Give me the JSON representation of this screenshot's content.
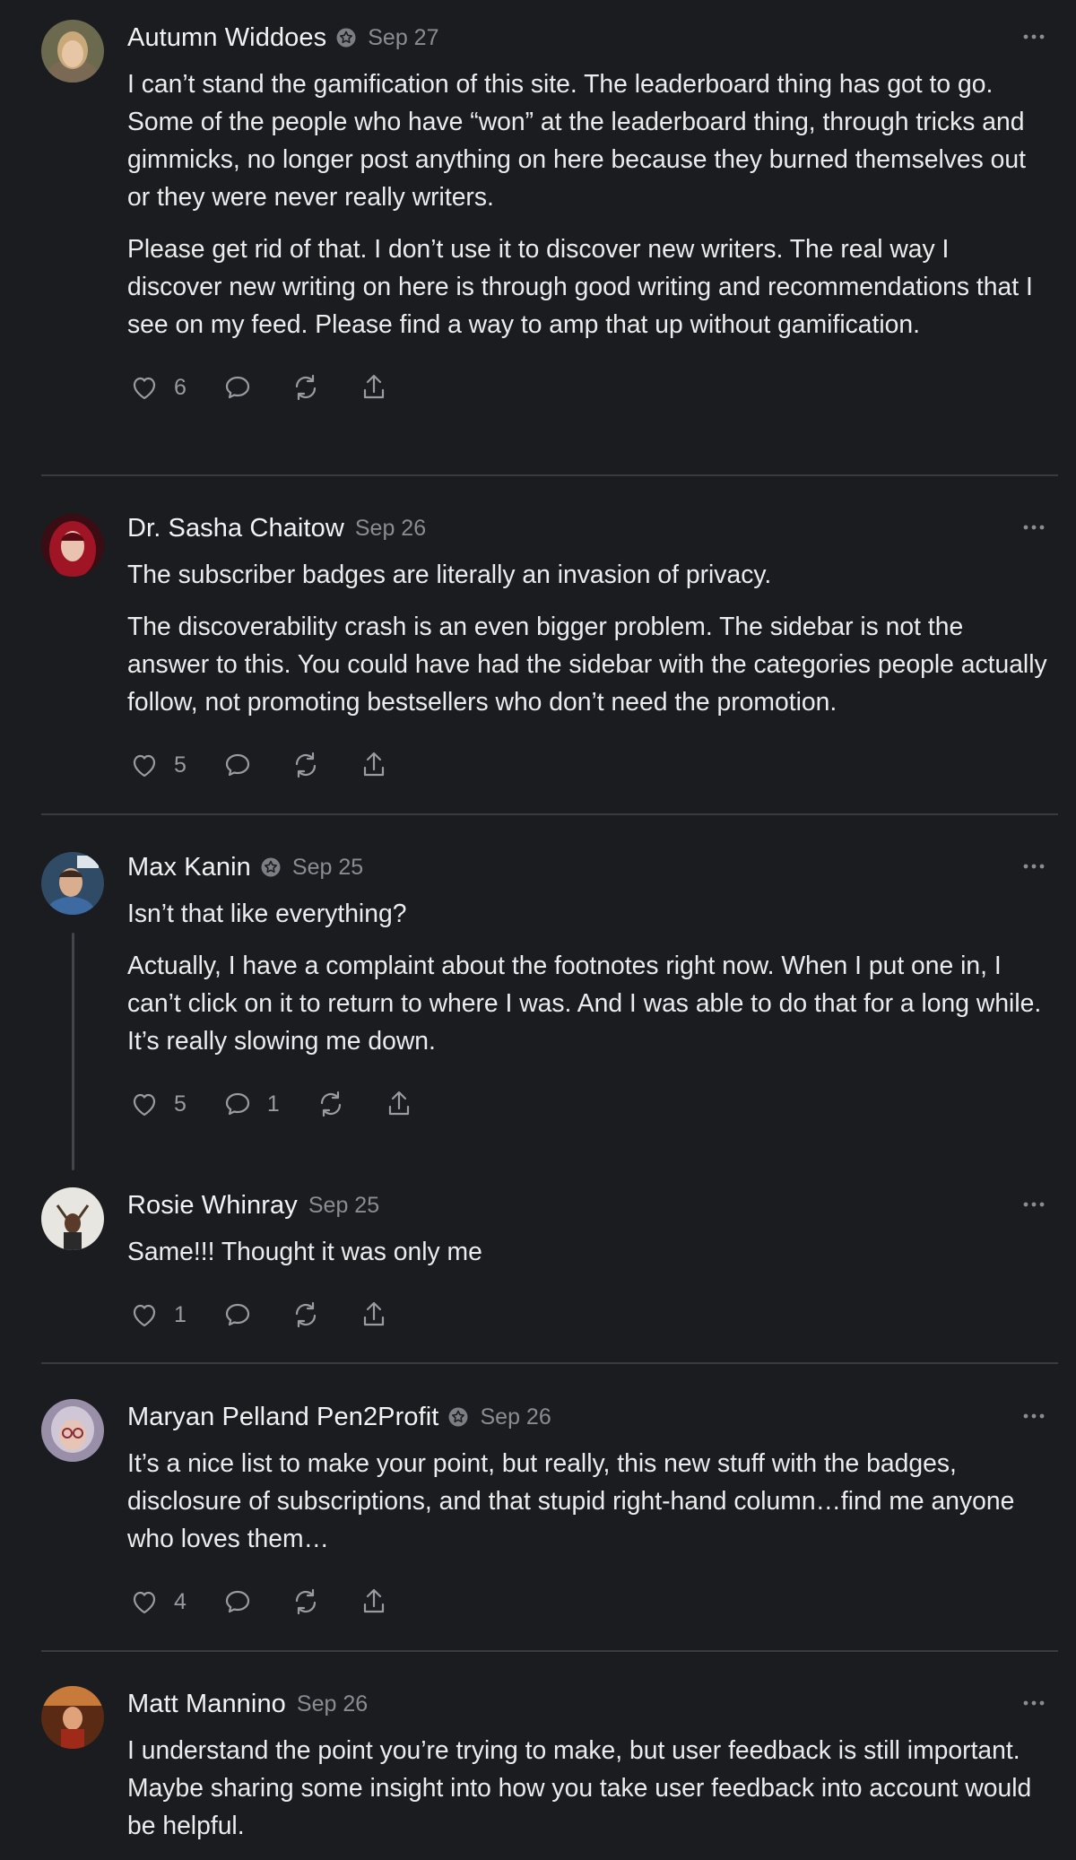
{
  "comments": [
    {
      "name": "Autumn Widdoes",
      "date": "Sep 27",
      "paragraphs": [
        "I can’t stand the gamification of this site. The leaderboard thing has got to go. Some of the people who have “won” at the leaderboard thing, through tricks and gimmicks, no longer post anything on here because they burned themselves out or they were never really writers.",
        "Please get rid of that. I don’t use it to discover new writers. The real way I discover new writing on here is through good writing and recommendations that I see on my feed. Please find a way to amp that up without gamification."
      ],
      "likes": "6",
      "replies": ""
    },
    {
      "name": "Dr. Sasha Chaitow",
      "date": "Sep 26",
      "paragraphs": [
        "The subscriber badges are literally an invasion of privacy.",
        "The discoverability crash is an even bigger problem. The sidebar is not the answer to this. You could have had the sidebar with the categories people actually follow, not promoting bestsellers who don’t need the promotion."
      ],
      "likes": "5",
      "replies": ""
    },
    {
      "name": "Max Kanin",
      "date": "Sep 25",
      "paragraphs": [
        "Isn’t that like everything?",
        "Actually, I have a complaint about the footnotes right now. When I put one in, I can’t click on it to return to where I was. And I was able to do that for a long while. It’s really slowing me down."
      ],
      "likes": "5",
      "replies": "1"
    },
    {
      "name": "Rosie Whinray",
      "date": "Sep 25",
      "paragraphs": [
        "Same!!! Thought it was only me"
      ],
      "likes": "1",
      "replies": ""
    },
    {
      "name": "Maryan Pelland Pen2Profit",
      "date": "Sep 26",
      "paragraphs": [
        "It’s a nice list to make your point, but really, this new stuff with the badges, disclosure of subscriptions, and that stupid right-hand column…find me anyone who loves them…"
      ],
      "likes": "4",
      "replies": ""
    },
    {
      "name": "Matt Mannino",
      "date": "Sep 26",
      "paragraphs": [
        "I understand the point you’re trying to make, but user feedback is still important. Maybe sharing some insight into how you take user feedback into account would be helpful."
      ],
      "likes": "",
      "replies": ""
    }
  ],
  "icons": {
    "like": "heart-icon",
    "reply": "comment-bubble-icon",
    "restack": "restack-icon",
    "share": "share-icon",
    "more": "more-dots-icon",
    "badge": "subscriber-badge-icon"
  },
  "colors": {
    "background": "#1b1c1f",
    "text": "#ececee",
    "muted": "#8b8c91",
    "divider": "#3a3b40"
  }
}
